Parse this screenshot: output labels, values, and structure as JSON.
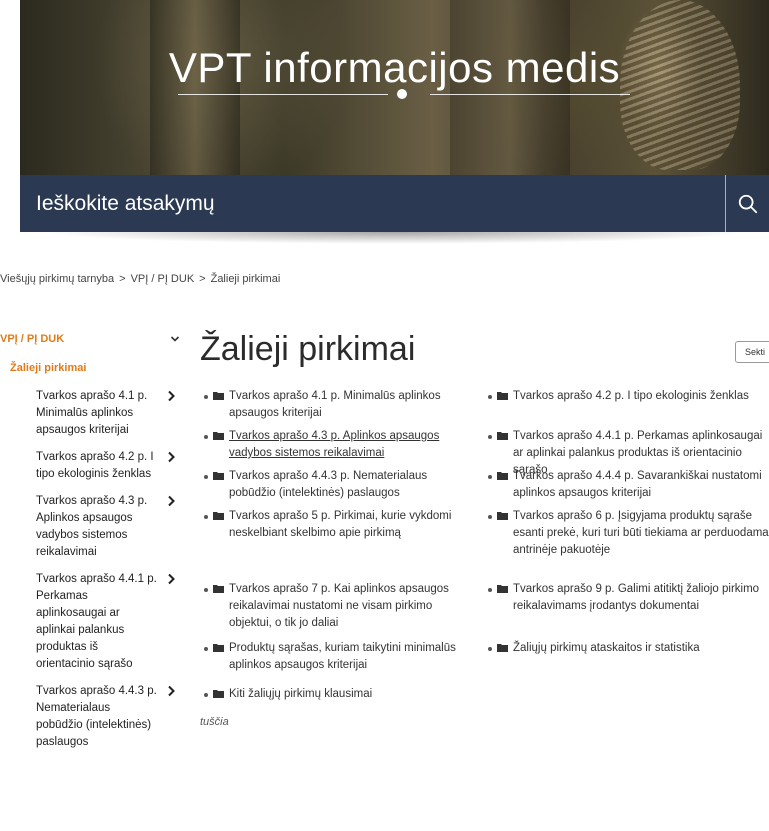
{
  "hero": {
    "title": "VPT informacijos medis"
  },
  "search": {
    "placeholder": "Ieškokite atsakymų"
  },
  "breadcrumb": [
    "Viešųjų pirkimų tarnyba",
    "VPĮ / PĮ DUK",
    "Žalieji pirkimai"
  ],
  "breadcrumb_sep": ">",
  "sidebar": {
    "root": "VPĮ / PĮ DUK",
    "active": "Žalieji pirkimai",
    "items": [
      "Tvarkos aprašo 4.1 p. Minimalūs aplinkos apsaugos kriterijai",
      "Tvarkos aprašo 4.2 p. I tipo ekologinis ženklas",
      "Tvarkos aprašo 4.3 p. Aplinkos apsaugos vadybos sistemos reikalavimai",
      "Tvarkos aprašo 4.4.1 p. Perkamas aplinkosaugai ar aplinkai palankus produktas iš orientacinio sąrašo",
      "Tvarkos aprašo 4.4.3 p. Nematerialaus pobūdžio (intelektinės) paslaugos"
    ]
  },
  "main": {
    "title": "Žalieji pirkimai",
    "follow": "Sekti",
    "items": [
      "Tvarkos aprašo 4.1 p. Minimalūs aplinkos apsaugos kriterijai",
      "Tvarkos aprašo 4.2 p. I tipo ekologinis ženklas",
      "Tvarkos aprašo 4.3 p. Aplinkos apsaugos vadybos sistemos reikalavimai",
      "Tvarkos aprašo 4.4.1 p. Perkamas aplinkosaugai ar aplinkai palankus produktas iš orientacinio sąrašo",
      "Tvarkos aprašo 4.4.3 p. Nematerialaus pobūdžio (intelektinės) paslaugos",
      "Tvarkos aprašo 4.4.4 p. Savarankiškai nustatomi aplinkos apsaugos kriterijai",
      "Tvarkos aprašo 5 p. Pirkimai, kurie vykdomi neskelbiant skelbimo apie pirkimą",
      "Tvarkos aprašo 6 p. Įsigyjama produktų sąraše esanti prekė, kuri turi būti tiekiama ar perduodama antrinėje pakuotėje",
      "Tvarkos aprašo 7 p. Kai aplinkos apsaugos reikalavimai nustatomi ne visam pirkimo objektui, o tik jo daliai",
      "Tvarkos aprašo 9 p. Galimi atitiktį žaliojo pirkimo reikalavimams įrodantys dokumentai",
      "Produktų sąrašas, kuriam taikytini minimalūs aplinkos apsaugos kriterijai",
      "Žaliųjų pirkimų ataskaitos ir statistika",
      "Kiti žaliųjų pirkimų klausimai"
    ],
    "empty": "tuščia"
  },
  "colors": {
    "accent": "#e07b1a",
    "search_bg": "#2b3a52"
  },
  "icons": {
    "search": "search-icon",
    "folder": "folder-icon",
    "chevron_down": "chevron-down-icon",
    "chevron_right": "chevron-right-icon"
  }
}
